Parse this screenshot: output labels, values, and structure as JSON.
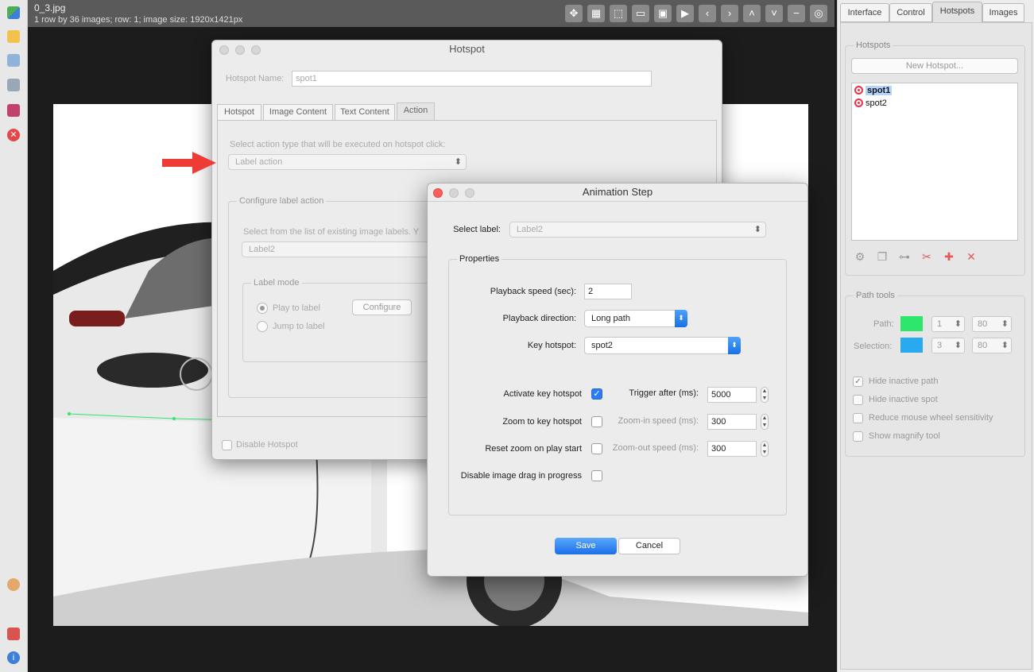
{
  "viewer": {
    "file_name": "0_3.jpg",
    "file_info": "1 row by 36 images; row: 1; image size: 1920x1421px"
  },
  "right_panel": {
    "tabs": [
      "Interface",
      "Control",
      "Hotspots",
      "Images"
    ],
    "active_tab": "Hotspots",
    "hotspots_group": {
      "title": "Hotspots",
      "new_button": "New Hotspot...",
      "items": [
        "spot1",
        "spot2"
      ],
      "selected": "spot1"
    },
    "path_tools": {
      "title": "Path tools",
      "path_label": "Path:",
      "path_color": "#2ee66b",
      "path_width": "1",
      "path_opacity": "80",
      "selection_label": "Selection:",
      "selection_color": "#29aaf0",
      "selection_width": "3",
      "selection_opacity": "80",
      "options": [
        {
          "label": "Hide inactive path",
          "checked": true
        },
        {
          "label": "Hide inactive spot",
          "checked": false
        },
        {
          "label": "Reduce mouse wheel sensitivity",
          "checked": false
        },
        {
          "label": "Show magnify tool",
          "checked": false
        }
      ]
    }
  },
  "hotspot_dialog": {
    "title": "Hotspot",
    "name_label": "Hotspot Name:",
    "name_value": "spot1",
    "tabs": [
      "Hotspot",
      "Image Content",
      "Text Content",
      "Action"
    ],
    "active_tab": "Action",
    "action_prompt": "Select action type that will be executed on hotspot click:",
    "action_value": "Label action",
    "configure_group": "Configure label action",
    "label_prompt": "Select from the list of existing image labels. Y",
    "label_value": "Label2",
    "label_mode_group": "Label mode",
    "mode_options": [
      "Play to label",
      "Jump to label"
    ],
    "configure_button": "Configure",
    "disable_label": "Disable Hotspot"
  },
  "animation_dialog": {
    "title": "Animation Step",
    "select_label": "Select label:",
    "select_value": "Label2",
    "properties_group": "Properties",
    "playback_speed_label": "Playback speed (sec):",
    "playback_speed_value": "2",
    "playback_direction_label": "Playback direction:",
    "playback_direction_value": "Long path",
    "key_hotspot_label": "Key hotspot:",
    "key_hotspot_value": "spot2",
    "activate_key_label": "Activate key hotspot",
    "activate_key_checked": true,
    "trigger_after_label": "Trigger after (ms):",
    "trigger_after_value": "5000",
    "zoom_key_label": "Zoom to key hotspot",
    "zoom_in_label": "Zoom-in speed (ms):",
    "zoom_in_value": "300",
    "reset_zoom_label": "Reset zoom on play start",
    "zoom_out_label": "Zoom-out speed (ms):",
    "zoom_out_value": "300",
    "disable_drag_label": "Disable image drag in progress",
    "save_button": "Save",
    "cancel_button": "Cancel"
  },
  "colors": {
    "accent_blue": "#2d7bf3",
    "arrow_red": "#ef3b36"
  }
}
